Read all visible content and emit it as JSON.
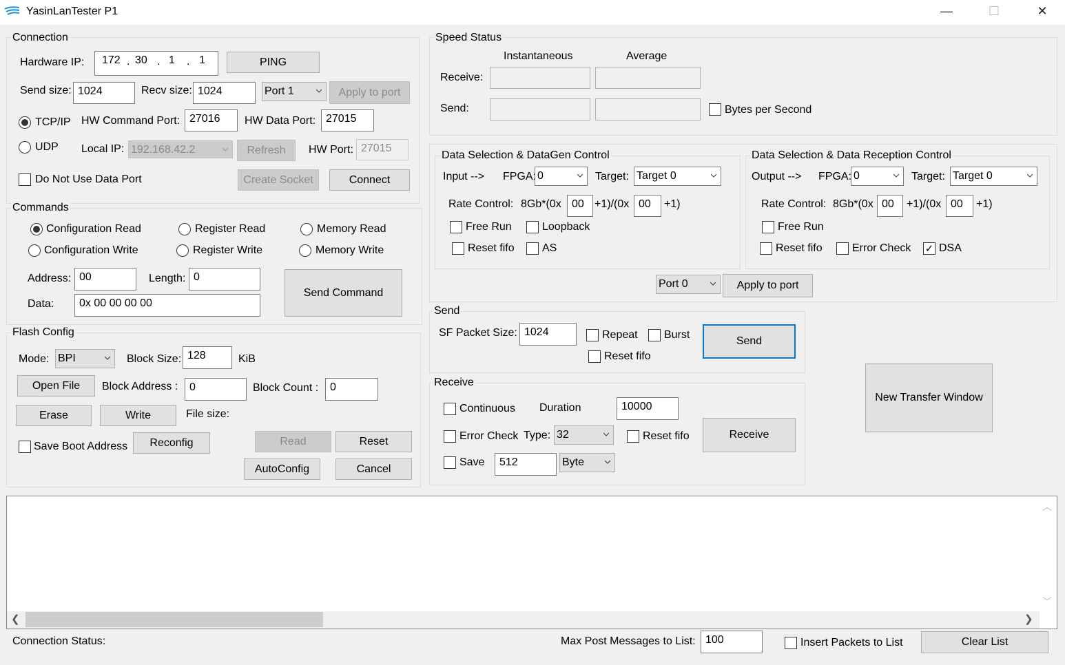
{
  "window": {
    "title": "YasinLanTester P1",
    "minimize": "—",
    "maximize": "☐",
    "close": "✕"
  },
  "connection": {
    "group": "Connection",
    "hw_ip_label": "Hardware IP:",
    "ip": [
      "172",
      "30",
      "1",
      "1"
    ],
    "ip_dot": ".",
    "ping": "PING",
    "send_size_label": "Send size:",
    "send_size": "1024",
    "recv_size_label": "Recv size:",
    "recv_size": "1024",
    "port": "Port 1",
    "apply": "Apply to port",
    "tcp": "TCP/IP",
    "udp": "UDP",
    "hw_cmd_port_label": "HW Command Port:",
    "hw_cmd_port": "27016",
    "hw_data_port_label": "HW Data Port:",
    "hw_data_port": "27015",
    "local_ip_label": "Local IP:",
    "local_ip": "192.168.42.2",
    "refresh": "Refresh",
    "hw_port_label": "HW Port:",
    "hw_port": "27015",
    "no_data_port": "Do Not Use Data Port",
    "create_socket": "Create Socket",
    "connect": "Connect"
  },
  "commands": {
    "group": "Commands",
    "config_read": "Configuration Read",
    "register_read": "Register Read",
    "memory_read": "Memory Read",
    "config_write": "Configuration Write",
    "register_write": "Register Write",
    "memory_write": "Memory Write",
    "address_label": "Address:",
    "address": "00",
    "length_label": "Length:",
    "length": "0",
    "data_label": "Data:",
    "data": "0x 00 00 00 00",
    "send_command": "Send Command"
  },
  "flash": {
    "group": "Flash Config",
    "mode_label": "Mode:",
    "mode": "BPI",
    "block_size_label": "Block Size:",
    "block_size": "128",
    "kib": "KiB",
    "open_file": "Open File",
    "block_address_label": "Block Address :",
    "block_address": "0",
    "block_count_label": "Block Count :",
    "block_count": "0",
    "erase": "Erase",
    "write": "Write",
    "file_size_label": "File size:",
    "save_boot": "Save Boot Address",
    "reconfig": "Reconfig",
    "read": "Read",
    "reset": "Reset",
    "autoconfig": "AutoConfig",
    "cancel": "Cancel"
  },
  "speed": {
    "group": "Speed Status",
    "instantaneous": "Instantaneous",
    "average": "Average",
    "receive_label": "Receive:",
    "send_label": "Send:",
    "bytes_per_second": "Bytes per Second"
  },
  "datagen": {
    "group": "Data Selection & DataGen Control",
    "input_label": "Input -->",
    "fpga_label": "FPGA:",
    "fpga": "0",
    "target_label": "Target:",
    "target": "Target 0",
    "rate_label": "Rate Control:",
    "rate_prefix": "8Gb*(0x",
    "rate_mid": "+1)/(0x",
    "rate_suffix": "+1)",
    "rate_a": "00",
    "rate_b": "00",
    "free_run": "Free Run",
    "loopback": "Loopback",
    "reset_fifo": "Reset fifo",
    "as": "AS"
  },
  "reception": {
    "group": "Data Selection & Data Reception Control",
    "output_label": "Output -->",
    "fpga_label": "FPGA:",
    "fpga": "0",
    "target_label": "Target:",
    "target": "Target 0",
    "rate_label": "Rate Control:",
    "rate_prefix": "8Gb*(0x",
    "rate_mid": "+1)/(0x",
    "rate_suffix": "+1)",
    "rate_a": "00",
    "rate_b": "00",
    "free_run": "Free Run",
    "reset_fifo": "Reset fifo",
    "error_check": "Error Check",
    "dsa": "DSA"
  },
  "port_apply": {
    "port": "Port 0",
    "apply": "Apply to port"
  },
  "send": {
    "group": "Send",
    "sf_label": "SF Packet Size:",
    "sf_size": "1024",
    "repeat": "Repeat",
    "burst": "Burst",
    "reset_fifo": "Reset fifo",
    "send": "Send"
  },
  "receive": {
    "group": "Receive",
    "continuous": "Continuous",
    "duration_label": "Duration",
    "duration": "10000",
    "error_check": "Error Check",
    "type_label": "Type:",
    "type": "32",
    "reset_fifo": "Reset fifo",
    "save": "Save",
    "save_size": "512",
    "unit": "Byte",
    "receive": "Receive"
  },
  "new_transfer": "New Transfer Window",
  "scroll": {
    "left": "❮",
    "right": "❯",
    "up": "︿",
    "down": "﹀"
  },
  "status": {
    "connection_label": "Connection Status:",
    "max_post_label": "Max Post Messages to List:",
    "max_post": "100",
    "insert_packets": "Insert Packets to List",
    "clear_list": "Clear List"
  },
  "checkbox_mark": "✓"
}
